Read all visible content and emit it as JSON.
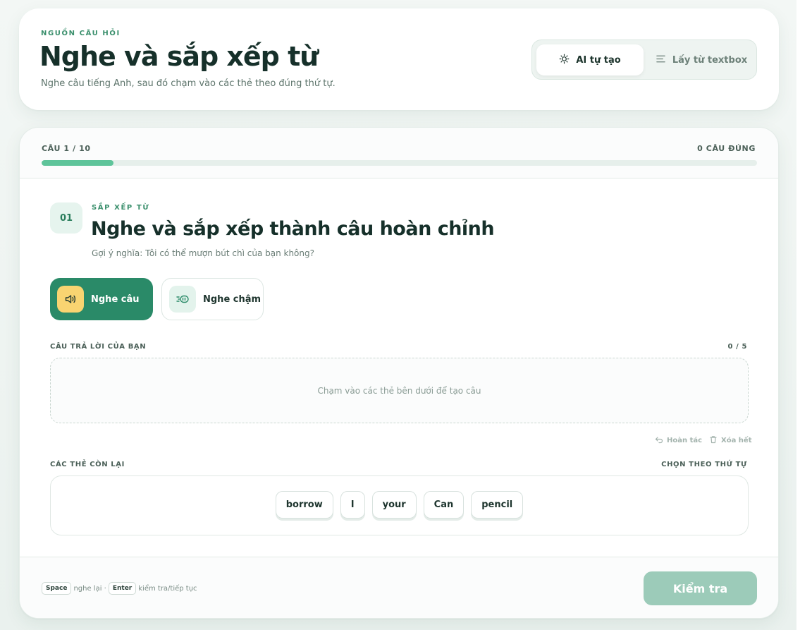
{
  "header": {
    "eyebrow": "NGUỒN CÂU HỎI",
    "title": "Nghe và sắp xếp từ",
    "subtitle": "Nghe câu tiếng Anh, sau đó chạm vào các thẻ theo đúng thứ tự.",
    "source_tabs": [
      {
        "label": "AI tự tạo",
        "icon": "sun-icon",
        "active": true
      },
      {
        "label": "Lấy từ textbox",
        "icon": "lines-icon",
        "active": false
      }
    ]
  },
  "progress": {
    "left_label": "CÂU 1 / 10",
    "right_label": "0 CÂU ĐÚNG",
    "fraction": 0.1,
    "color": "#5ec49a"
  },
  "question": {
    "number": "01",
    "eyebrow": "SẮP XẾP TỪ",
    "title": "Nghe và sắp xếp thành câu hoàn chỉnh",
    "hint": "Gợi ý nghĩa: Tôi có thể mượn bút chì của bạn không?"
  },
  "listen": {
    "normal_label": "Nghe câu",
    "slow_label": "Nghe chậm"
  },
  "answer": {
    "label": "CÂU TRẢ LỜI CỦA BẠN",
    "count": "0 / 5",
    "placeholder": "Chạm vào các thẻ bên dưới để tạo câu",
    "undo_label": "Hoàn tác",
    "clear_label": "Xóa hết"
  },
  "remaining": {
    "label": "CÁC THẺ CÒN LẠI",
    "hint": "CHỌN THEO THỨ TỰ",
    "words": [
      "borrow",
      "I",
      "your",
      "Can",
      "pencil"
    ]
  },
  "footer": {
    "key1": "Space",
    "key1_text": "nghe lại ·",
    "key2": "Enter",
    "key2_text": "kiểm tra/tiếp tục",
    "check_label": "Kiểm tra"
  },
  "colors": {
    "accent": "#2a8a68",
    "speaker_bg": "#f9d471",
    "check_disabled": "#9ccbb9"
  }
}
